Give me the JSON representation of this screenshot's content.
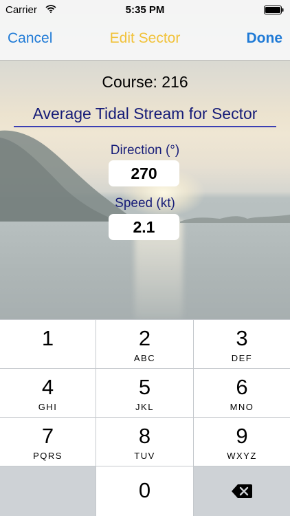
{
  "status_bar": {
    "carrier": "Carrier",
    "time": "5:35 PM"
  },
  "nav": {
    "cancel": "Cancel",
    "title": "Edit Sector",
    "done": "Done"
  },
  "content": {
    "course": "Course: 216",
    "section_title": "Average Tidal Stream for Sector",
    "direction_label": "Direction (°)",
    "direction_value": "270",
    "speed_label": "Speed (kt)",
    "speed_value": "2.1"
  },
  "keypad": {
    "keys": [
      {
        "num": "1",
        "letters": ""
      },
      {
        "num": "2",
        "letters": "ABC"
      },
      {
        "num": "3",
        "letters": "DEF"
      },
      {
        "num": "4",
        "letters": "GHI"
      },
      {
        "num": "5",
        "letters": "JKL"
      },
      {
        "num": "6",
        "letters": "MNO"
      },
      {
        "num": "7",
        "letters": "PQRS"
      },
      {
        "num": "8",
        "letters": "TUV"
      },
      {
        "num": "9",
        "letters": "WXYZ"
      },
      {
        "num": "0",
        "letters": ""
      }
    ],
    "delete_icon": "backspace-icon"
  },
  "colors": {
    "accent_blue": "#1f7ad6",
    "title_yellow": "#f1c23a",
    "label_navy": "#161c78"
  }
}
